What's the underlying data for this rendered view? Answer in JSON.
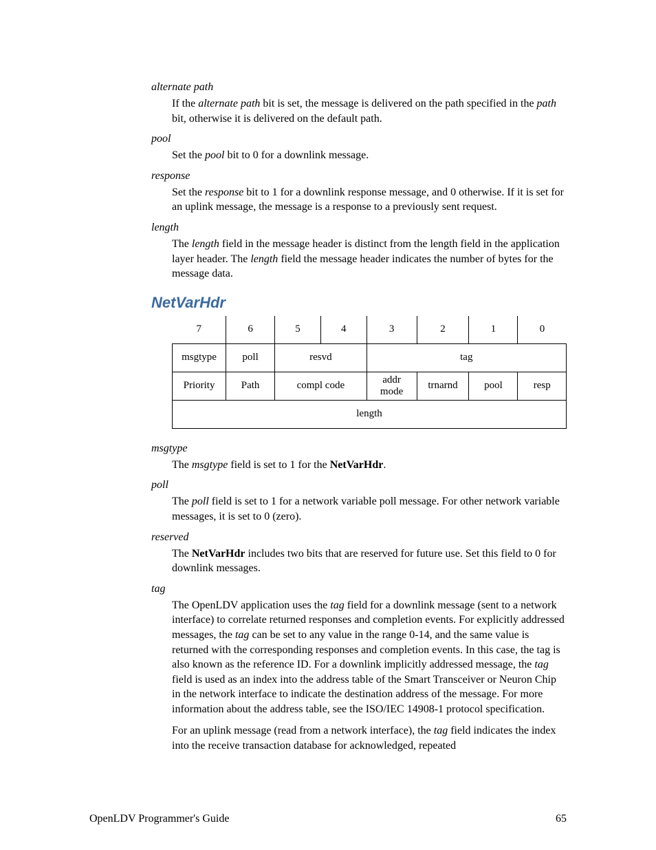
{
  "defs1": {
    "alternate_path": {
      "term": "alternate path",
      "text_a": "If the ",
      "em_a": "alternate path",
      "text_b": " bit is set, the message is delivered on the path specified in the ",
      "em_b": "path",
      "text_c": " bit, otherwise it is delivered on the default path."
    },
    "pool": {
      "term": "pool",
      "text_a": "Set the ",
      "em_a": "pool",
      "text_b": " bit to 0 for a downlink message."
    },
    "response": {
      "term": "response",
      "text_a": "Set the ",
      "em_a": "response",
      "text_b": " bit to 1 for a downlink response message, and 0 otherwise.  If it is set for an uplink message, the message is a response to a previously sent request."
    },
    "length": {
      "term": "length",
      "text_a": "The ",
      "em_a": "length",
      "text_b": " field in the message header is distinct from the length field in the application layer header.  The ",
      "em_b": "length",
      "text_c": " field the message header indicates the number of bytes for the message data."
    }
  },
  "heading": "NetVarHdr",
  "table": {
    "bits": [
      "7",
      "6",
      "5",
      "4",
      "3",
      "2",
      "1",
      "0"
    ],
    "row1": {
      "msgtype": "msgtype",
      "poll": "poll",
      "resvd": "resvd",
      "tag": "tag"
    },
    "row2": {
      "priority": "Priority",
      "path": "Path",
      "compl": "compl code",
      "addr": "addr mode",
      "trnarnd": "trnarnd",
      "pool": "pool",
      "resp": "resp"
    },
    "row3": {
      "length": "length"
    }
  },
  "defs2": {
    "msgtype": {
      "term": "msgtype",
      "text_a": "The ",
      "em_a": "msgtype",
      "text_b": " field is set to 1 for the ",
      "strong": "NetVarHdr",
      "text_c": "."
    },
    "poll": {
      "term": "poll",
      "text_a": "The ",
      "em_a": "poll",
      "text_b": " field is set to 1 for a network variable poll message.  For other network variable messages, it is set to 0 (zero)."
    },
    "reserved": {
      "term": "reserved",
      "text_a": "The ",
      "strong": "NetVarHdr",
      "text_b": " includes two bits that are reserved for future use.  Set this field to 0 for downlink messages."
    },
    "tag": {
      "term": "tag",
      "p1_a": "The OpenLDV application uses the ",
      "p1_em1": "tag",
      "p1_b": " field for a downlink message (sent to a network interface) to correlate returned responses and completion events.  For explicitly addressed messages, the ",
      "p1_em2": "tag",
      "p1_c": " can be set to any value in the range 0-14, and the same value is returned with the corresponding responses and completion events.  In this case, the tag is also known as the reference ID.  For a downlink implicitly addressed message, the ",
      "p1_em3": "tag",
      "p1_d": " field is used as an index into the address table of the Smart Transceiver or Neuron Chip in the network interface to indicate the destination address of the message.  For more information about the address table, see the ISO/IEC 14908-1 protocol specification.",
      "p2_a": "For an uplink message (read from a network interface), the ",
      "p2_em": "tag",
      "p2_b": " field indicates the index into the receive transaction database for acknowledged, repeated"
    }
  },
  "footer": {
    "title": "OpenLDV Programmer's Guide",
    "page": "65"
  }
}
